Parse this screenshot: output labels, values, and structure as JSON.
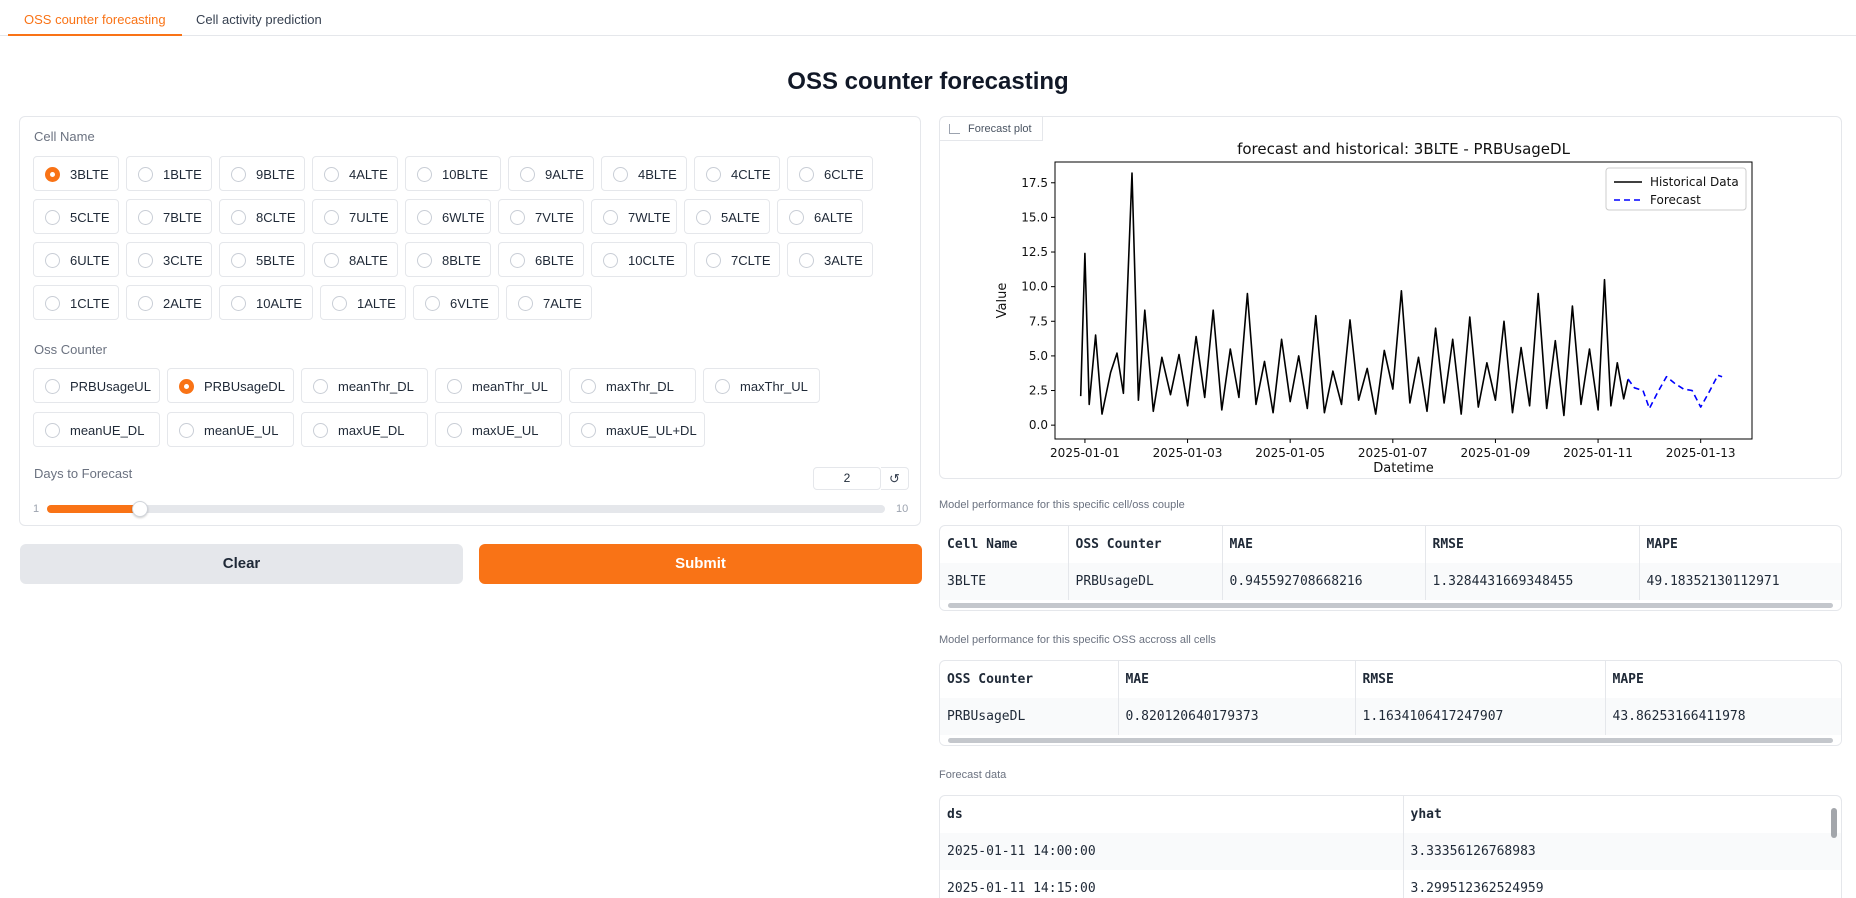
{
  "tabs": [
    {
      "label": "OSS counter forecasting",
      "active": true
    },
    {
      "label": "Cell activity prediction",
      "active": false
    }
  ],
  "page_title": "OSS counter forecasting",
  "cell_name": {
    "label": "Cell Name",
    "selected": "3BLTE",
    "options": [
      "3BLTE",
      "1BLTE",
      "9BLTE",
      "4ALTE",
      "10BLTE",
      "9ALTE",
      "4BLTE",
      "4CLTE",
      "6CLTE",
      "5CLTE",
      "7BLTE",
      "8CLTE",
      "7ULTE",
      "6WLTE",
      "7VLTE",
      "7WLTE",
      "5ALTE",
      "6ALTE",
      "6ULTE",
      "3CLTE",
      "5BLTE",
      "8ALTE",
      "8BLTE",
      "6BLTE",
      "10CLTE",
      "7CLTE",
      "3ALTE",
      "1CLTE",
      "2ALTE",
      "10ALTE",
      "1ALTE",
      "6VLTE",
      "7ALTE"
    ]
  },
  "oss_counter": {
    "label": "Oss Counter",
    "selected": "PRBUsageDL",
    "options": [
      "PRBUsageUL",
      "PRBUsageDL",
      "meanThr_DL",
      "meanThr_UL",
      "maxThr_DL",
      "maxThr_UL",
      "meanUE_DL",
      "meanUE_UL",
      "maxUE_DL",
      "maxUE_UL",
      "maxUE_UL+DL"
    ]
  },
  "days_to_forecast": {
    "label": "Days to Forecast",
    "value": "2",
    "min": "1",
    "max": "10",
    "reset_icon": "↺"
  },
  "buttons": {
    "clear": "Clear",
    "submit": "Submit"
  },
  "plot": {
    "label": "Forecast plot",
    "icon": "chart-icon"
  },
  "chart_data": {
    "type": "line",
    "title": "forecast and historical: 3BLTE - PRBUsageDL",
    "xlabel": "Datetime",
    "ylabel": "Value",
    "xlim": [
      "2024-12-31T10:00",
      "2025-01-14T00:00"
    ],
    "ylim": [
      -1.0,
      19.0
    ],
    "xticks": [
      "2025-01-01",
      "2025-01-03",
      "2025-01-05",
      "2025-01-07",
      "2025-01-09",
      "2025-01-11",
      "2025-01-13"
    ],
    "yticks": [
      "0.0",
      "2.5",
      "5.0",
      "7.5",
      "10.0",
      "12.5",
      "15.0",
      "17.5"
    ],
    "legend": {
      "placement": "top-right",
      "entries": [
        "Historical Data",
        "Forecast"
      ]
    },
    "grid": false,
    "series": [
      {
        "name": "Historical Data",
        "color": "#000000",
        "style": "solid",
        "points": [
          [
            "2024-12-31T22:00",
            2.1
          ],
          [
            "2025-01-01T00:00",
            12.4
          ],
          [
            "2025-01-01T02:00",
            1.5
          ],
          [
            "2025-01-01T05:00",
            6.5
          ],
          [
            "2025-01-01T08:00",
            0.8
          ],
          [
            "2025-01-01T12:00",
            3.8
          ],
          [
            "2025-01-01T15:00",
            5.2
          ],
          [
            "2025-01-01T18:00",
            2.3
          ],
          [
            "2025-01-01T22:00",
            18.2
          ],
          [
            "2025-01-02T01:00",
            1.8
          ],
          [
            "2025-01-02T04:00",
            8.3
          ],
          [
            "2025-01-02T08:00",
            1.0
          ],
          [
            "2025-01-02T12:00",
            4.9
          ],
          [
            "2025-01-02T16:00",
            2.2
          ],
          [
            "2025-01-02T20:00",
            5.1
          ],
          [
            "2025-01-03T00:00",
            1.4
          ],
          [
            "2025-01-03T04:00",
            6.4
          ],
          [
            "2025-01-03T08:00",
            2.0
          ],
          [
            "2025-01-03T12:00",
            8.3
          ],
          [
            "2025-01-03T16:00",
            1.1
          ],
          [
            "2025-01-03T20:00",
            5.5
          ],
          [
            "2025-01-04T00:00",
            2.0
          ],
          [
            "2025-01-04T04:00",
            9.5
          ],
          [
            "2025-01-04T08:00",
            1.5
          ],
          [
            "2025-01-04T12:00",
            4.6
          ],
          [
            "2025-01-04T16:00",
            0.9
          ],
          [
            "2025-01-04T20:00",
            6.2
          ],
          [
            "2025-01-05T00:00",
            1.7
          ],
          [
            "2025-01-05T04:00",
            5.0
          ],
          [
            "2025-01-05T08:00",
            1.2
          ],
          [
            "2025-01-05T12:00",
            7.9
          ],
          [
            "2025-01-05T16:00",
            0.9
          ],
          [
            "2025-01-05T20:00",
            3.9
          ],
          [
            "2025-01-06T00:00",
            1.5
          ],
          [
            "2025-01-06T04:00",
            7.6
          ],
          [
            "2025-01-06T08:00",
            1.8
          ],
          [
            "2025-01-06T12:00",
            4.1
          ],
          [
            "2025-01-06T16:00",
            0.8
          ],
          [
            "2025-01-06T20:00",
            5.4
          ],
          [
            "2025-01-07T00:00",
            2.6
          ],
          [
            "2025-01-07T04:00",
            9.7
          ],
          [
            "2025-01-07T08:00",
            1.6
          ],
          [
            "2025-01-07T12:00",
            4.9
          ],
          [
            "2025-01-07T16:00",
            1.0
          ],
          [
            "2025-01-07T20:00",
            7.0
          ],
          [
            "2025-01-08T00:00",
            1.6
          ],
          [
            "2025-01-08T04:00",
            6.2
          ],
          [
            "2025-01-08T08:00",
            0.8
          ],
          [
            "2025-01-08T12:00",
            7.8
          ],
          [
            "2025-01-08T16:00",
            1.3
          ],
          [
            "2025-01-08T20:00",
            4.5
          ],
          [
            "2025-01-09T00:00",
            1.8
          ],
          [
            "2025-01-09T04:00",
            7.5
          ],
          [
            "2025-01-09T08:00",
            0.9
          ],
          [
            "2025-01-09T12:00",
            5.6
          ],
          [
            "2025-01-09T16:00",
            1.4
          ],
          [
            "2025-01-09T20:00",
            9.5
          ],
          [
            "2025-01-10T00:00",
            1.2
          ],
          [
            "2025-01-10T04:00",
            6.1
          ],
          [
            "2025-01-10T08:00",
            0.7
          ],
          [
            "2025-01-10T12:00",
            8.6
          ],
          [
            "2025-01-10T16:00",
            1.5
          ],
          [
            "2025-01-10T20:00",
            5.5
          ],
          [
            "2025-01-11T00:00",
            1.1
          ],
          [
            "2025-01-11T03:00",
            10.5
          ],
          [
            "2025-01-11T06:00",
            1.4
          ],
          [
            "2025-01-11T09:00",
            4.5
          ],
          [
            "2025-01-11T12:00",
            1.9
          ],
          [
            "2025-01-11T14:00",
            3.3
          ]
        ]
      },
      {
        "name": "Forecast",
        "color": "#0000ff",
        "style": "dashed",
        "points": [
          [
            "2025-01-11T14:00",
            3.33
          ],
          [
            "2025-01-11T17:00",
            2.7
          ],
          [
            "2025-01-11T21:00",
            2.5
          ],
          [
            "2025-01-12T00:00",
            1.2
          ],
          [
            "2025-01-12T04:00",
            2.4
          ],
          [
            "2025-01-12T08:00",
            3.5
          ],
          [
            "2025-01-12T12:00",
            3.0
          ],
          [
            "2025-01-12T16:00",
            2.6
          ],
          [
            "2025-01-12T20:00",
            2.5
          ],
          [
            "2025-01-13T00:00",
            1.3
          ],
          [
            "2025-01-13T04:00",
            2.4
          ],
          [
            "2025-01-13T08:00",
            3.6
          ],
          [
            "2025-01-13T10:00",
            3.5
          ]
        ]
      }
    ]
  },
  "cell_perf": {
    "label": "Model performance for this specific cell/oss couple",
    "headers": [
      "Cell Name",
      "OSS Counter",
      "MAE",
      "RMSE",
      "MAPE"
    ],
    "row": [
      "3BLTE",
      "PRBUsageDL",
      "0.945592708668216",
      "1.3284431669348455",
      "49.18352130112971"
    ]
  },
  "oss_perf": {
    "label": "Model performance for this specific OSS accross all cells",
    "headers": [
      "OSS Counter",
      "MAE",
      "RMSE",
      "MAPE"
    ],
    "row": [
      "PRBUsageDL",
      "0.820120640179373",
      "1.1634106417247907",
      "43.86253166411978"
    ]
  },
  "forecast_data": {
    "label": "Forecast data",
    "headers": [
      "ds",
      "yhat"
    ],
    "rows": [
      [
        "2025-01-11 14:00:00",
        "3.33356126768983"
      ],
      [
        "2025-01-11 14:15:00",
        "3.299512362524959"
      ]
    ]
  }
}
